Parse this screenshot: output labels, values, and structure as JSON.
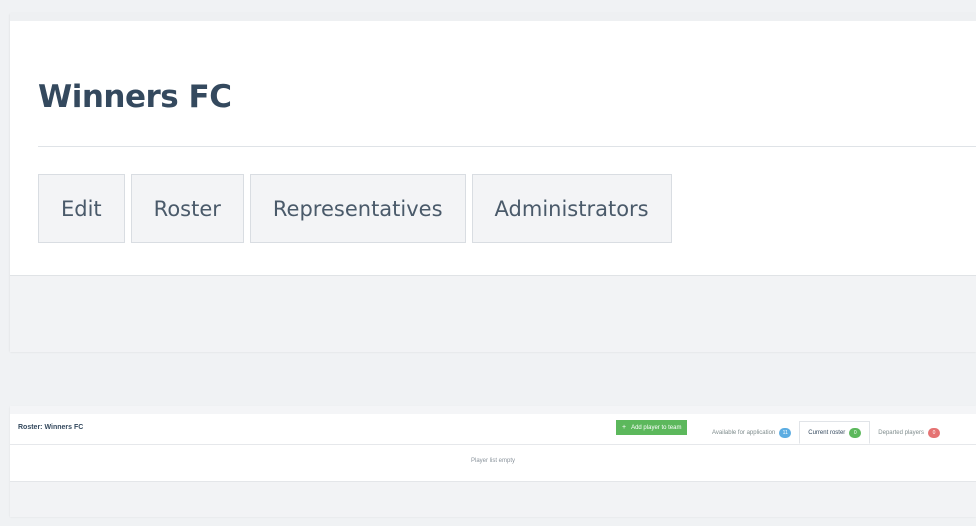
{
  "team": {
    "title": "Winners FC"
  },
  "nav_tabs": [
    {
      "label": "Edit"
    },
    {
      "label": "Roster"
    },
    {
      "label": "Representatives"
    },
    {
      "label": "Administrators"
    }
  ],
  "roster": {
    "title": "Roster: Winners FC",
    "add_button_label": "Add player to team",
    "add_button_icon": "+",
    "tabs": [
      {
        "label": "Available for application",
        "count": "11",
        "badge_color": "#5dade2"
      },
      {
        "label": "Current roster",
        "count": "0",
        "badge_color": "#5cb85c"
      },
      {
        "label": "Departed players",
        "count": "0",
        "badge_color": "#e57373"
      }
    ],
    "empty_message": "Player list empty"
  },
  "colors": {
    "accent_green": "#5cb85c",
    "title_text": "#34495e"
  }
}
